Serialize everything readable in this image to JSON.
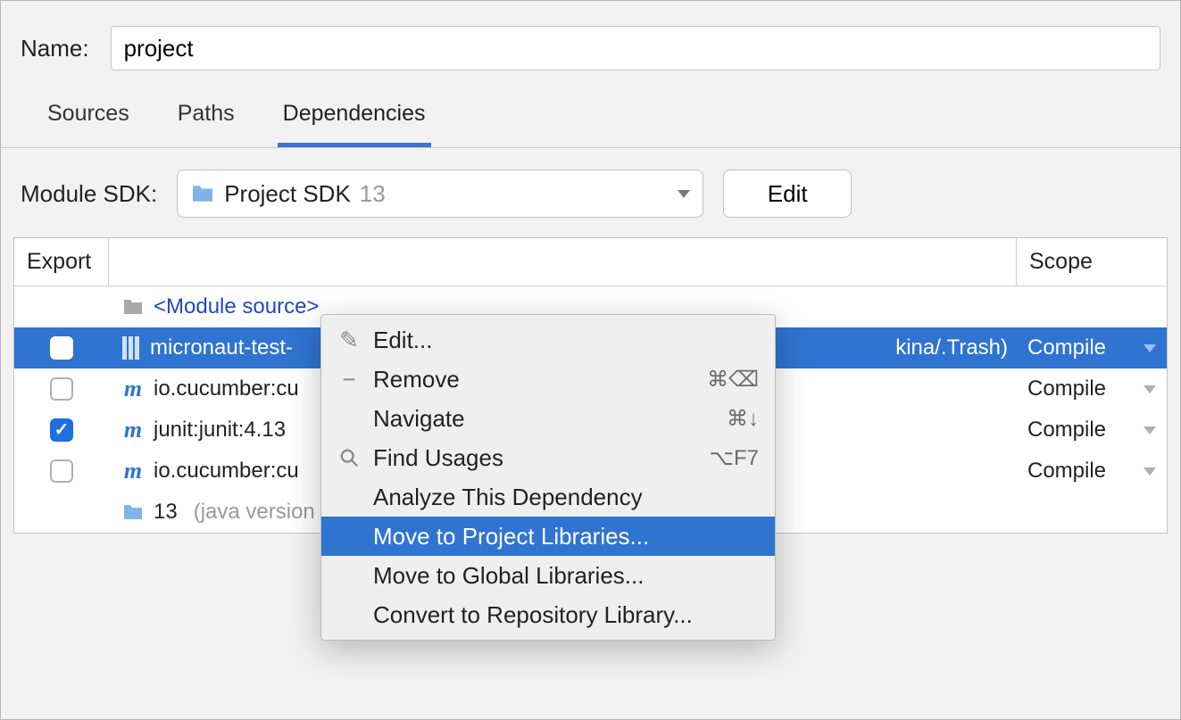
{
  "name": {
    "label": "Name:",
    "value": "project"
  },
  "tabs": [
    {
      "label": "Sources",
      "active": false
    },
    {
      "label": "Paths",
      "active": false
    },
    {
      "label": "Dependencies",
      "active": true
    }
  ],
  "sdk": {
    "label": "Module SDK:",
    "selected_text": "Project SDK",
    "selected_version": "13",
    "edit_button": "Edit"
  },
  "table": {
    "headers": {
      "export": "Export",
      "name": "",
      "scope": "Scope"
    },
    "rows": [
      {
        "type": "module-source",
        "checked": null,
        "icon": "folder",
        "name": "<Module source>",
        "scope": "",
        "selected": false
      },
      {
        "type": "lib",
        "checked": false,
        "icon": "library",
        "name": "micronaut-test-",
        "trail": "kina/.Trash)",
        "scope": "Compile",
        "selected": true
      },
      {
        "type": "maven",
        "checked": false,
        "icon": "m",
        "name": "io.cucumber:cu",
        "scope": "Compile",
        "selected": false
      },
      {
        "type": "maven",
        "checked": true,
        "icon": "m",
        "name": "junit:junit:4.13",
        "scope": "Compile",
        "selected": false
      },
      {
        "type": "maven",
        "checked": false,
        "icon": "m",
        "name": "io.cucumber:cu",
        "scope": "Compile",
        "selected": false
      },
      {
        "type": "sdk",
        "checked": null,
        "icon": "sdk-folder",
        "name": "13",
        "detail": "(java version",
        "scope": "",
        "selected": false
      }
    ]
  },
  "context_menu": {
    "items": [
      {
        "icon": "pencil-icon",
        "label": "Edit...",
        "shortcut": "",
        "highlight": false
      },
      {
        "icon": "minus-icon",
        "label": "Remove",
        "shortcut": "⌘⌫",
        "highlight": false
      },
      {
        "icon": "",
        "label": "Navigate",
        "shortcut": "⌘↓",
        "highlight": false
      },
      {
        "icon": "search-icon",
        "label": "Find Usages",
        "shortcut": "⌥F7",
        "highlight": false
      },
      {
        "icon": "",
        "label": "Analyze This Dependency",
        "shortcut": "",
        "highlight": false
      },
      {
        "icon": "",
        "label": "Move to Project Libraries...",
        "shortcut": "",
        "highlight": true
      },
      {
        "icon": "",
        "label": "Move to Global Libraries...",
        "shortcut": "",
        "highlight": false
      },
      {
        "icon": "",
        "label": "Convert to Repository Library...",
        "shortcut": "",
        "highlight": false
      }
    ]
  }
}
